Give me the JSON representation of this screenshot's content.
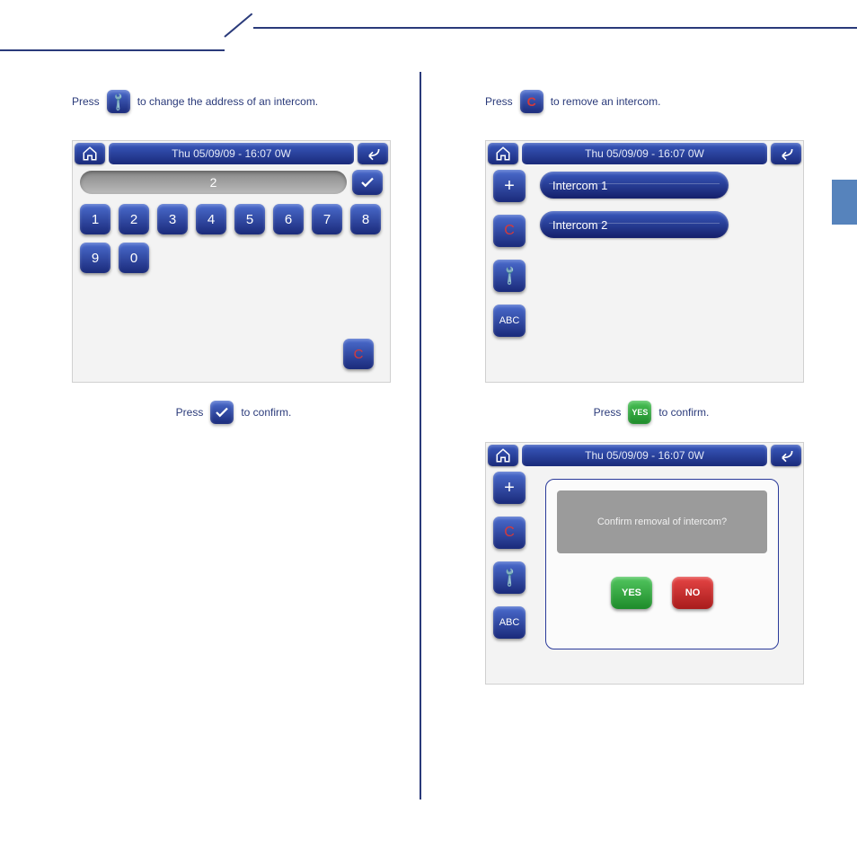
{
  "header_datetime": "Thu 05/09/09 - 16:07   0W",
  "left": {
    "intro1_prefix": "Press",
    "intro1_suffix": "to change the address of an intercom.",
    "numpad_display": "2",
    "keys": [
      "1",
      "2",
      "3",
      "4",
      "5",
      "6",
      "7",
      "8",
      "9",
      "0"
    ],
    "clear_label": "C",
    "intro2_prefix": "Press",
    "intro2_suffix": "to confirm."
  },
  "right": {
    "intro1_prefix": "Press",
    "intro1_suffix": "to remove an intercom.",
    "list_items": [
      "Intercom 1",
      "Intercom 2"
    ],
    "side_add": "+",
    "side_clear": "C",
    "side_abc": "ABC",
    "intro2_prefix": "Press",
    "intro2_suffix": "to confirm.",
    "yes_mini": "YES",
    "dialog_msg": "Confirm removal of intercom?",
    "dialog_yes": "YES",
    "dialog_no": "NO"
  }
}
